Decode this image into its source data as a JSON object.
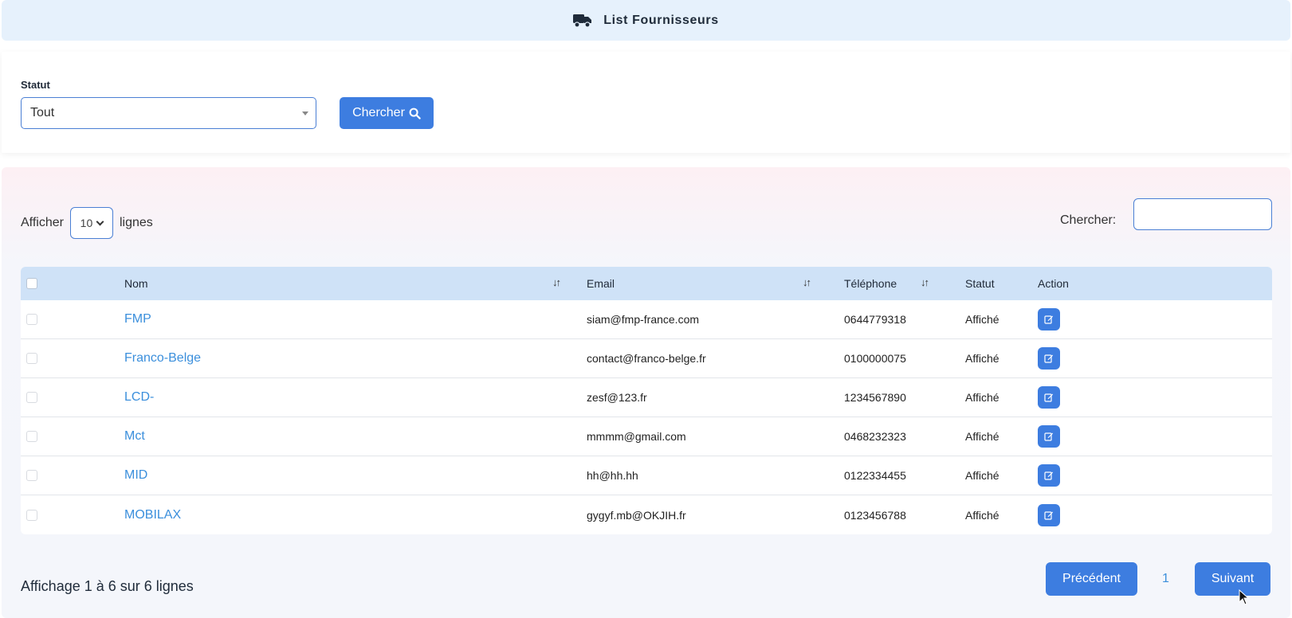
{
  "header": {
    "title": "List Fournisseurs",
    "icon": "truck-icon"
  },
  "filter": {
    "statut_label": "Statut",
    "statut_value": "Tout",
    "search_button": "Chercher"
  },
  "table_controls": {
    "show_prefix": "Afficher",
    "page_length": "10",
    "show_suffix": "lignes",
    "search_label": "Chercher:",
    "search_value": ""
  },
  "columns": {
    "nom": "Nom",
    "email": "Email",
    "telephone": "Téléphone",
    "statut": "Statut",
    "action": "Action"
  },
  "rows": [
    {
      "nom": "FMP",
      "email": "siam@fmp-france.com",
      "telephone": "0644779318",
      "statut": "Affiché"
    },
    {
      "nom": "Franco-Belge",
      "email": "contact@franco-belge.fr",
      "telephone": "0100000075",
      "statut": "Affiché"
    },
    {
      "nom": "LCD-",
      "email": "zesf@123.fr",
      "telephone": "1234567890",
      "statut": "Affiché"
    },
    {
      "nom": "Mct",
      "email": "mmmm@gmail.com",
      "telephone": "0468232323",
      "statut": "Affiché"
    },
    {
      "nom": "MID",
      "email": "hh@hh.hh",
      "telephone": "0122334455",
      "statut": "Affiché"
    },
    {
      "nom": "MOBILAX",
      "email": "gygyf.mb@OKJIH.fr",
      "telephone": "0123456788",
      "statut": "Affiché"
    }
  ],
  "footer": {
    "info": "Affichage 1 à 6 sur 6 lignes",
    "prev": "Précédent",
    "page": "1",
    "next": "Suivant"
  },
  "colors": {
    "accent": "#3d7de0",
    "link": "#3b8fdc",
    "header_bg": "#e6f1fc",
    "thead_bg": "#cfe2f7"
  }
}
